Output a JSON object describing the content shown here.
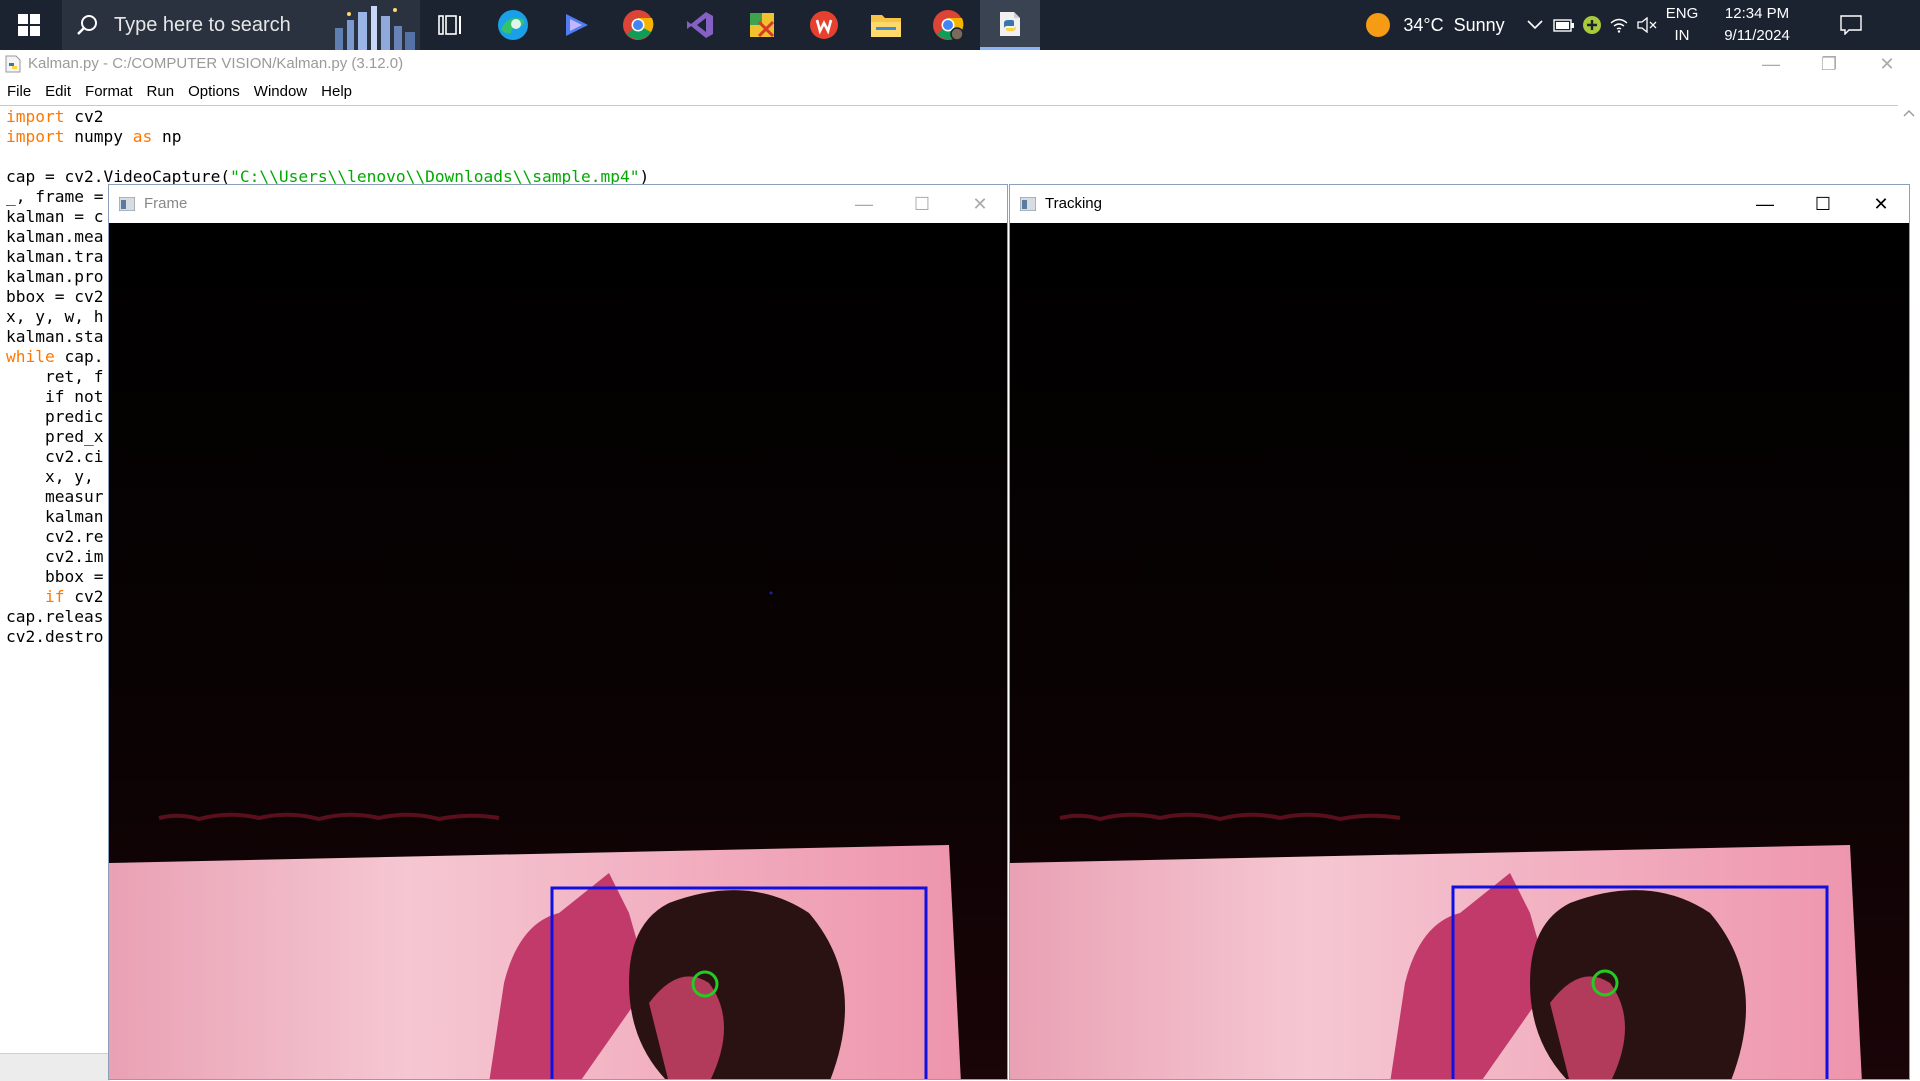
{
  "taskbar": {
    "search_placeholder": "Type here to search",
    "pinned": [
      {
        "name": "task-view"
      },
      {
        "name": "edge"
      },
      {
        "name": "copilot"
      },
      {
        "name": "chrome"
      },
      {
        "name": "visual-studio"
      },
      {
        "name": "app-green"
      },
      {
        "name": "wps-office"
      },
      {
        "name": "file-explorer"
      },
      {
        "name": "chrome-profile"
      },
      {
        "name": "python-idle",
        "active": true
      }
    ],
    "weather": {
      "temp": "34°C",
      "condition": "Sunny"
    },
    "lang": {
      "line1": "ENG",
      "line2": "IN"
    },
    "clock": {
      "time": "12:34 PM",
      "date": "9/11/2024"
    }
  },
  "idle": {
    "title": "Kalman.py - C:/COMPUTER VISION/Kalman.py (3.12.0)",
    "menu": [
      "File",
      "Edit",
      "Format",
      "Run",
      "Options",
      "Window",
      "Help"
    ],
    "code": {
      "l1_kw": "import",
      "l1_rest": " cv2",
      "l2_kw": "import",
      "l2_mid": " numpy ",
      "l2_kw2": "as",
      "l2_rest": " np",
      "l4_pre": "cap = cv2.VideoCapture(",
      "l4_str": "\"C:\\\\Users\\\\lenovo\\\\Downloads\\\\sample.mp4\"",
      "l4_post": ")",
      "l5": "_, frame =",
      "l6": "kalman = c",
      "l7": "kalman.mea",
      "l8": "kalman.tra",
      "l9": "kalman.pro",
      "l10": "bbox = cv2",
      "l11": "x, y, w, h",
      "l12": "kalman.sta",
      "l13_kw": "while",
      "l13_rest": " cap.",
      "l14": "    ret, f",
      "l15_kw": "    if not",
      "l16": "    predic",
      "l17": "    pred_x",
      "l18": "    cv2.ci",
      "l19": "    x, y, ",
      "l20": "    measur",
      "l21": "    kalman",
      "l22": "    cv2.re",
      "l23": "    cv2.im",
      "l24": "    bbox =",
      "l25_kw": "    if",
      "l25_rest": " cv2",
      "l26": "cap.releas",
      "l27": "cv2.destro"
    }
  },
  "windows": {
    "frame": {
      "title": "Frame"
    },
    "tracking": {
      "title": "Tracking"
    }
  },
  "colors": {
    "taskbar_bg": "#1c2330",
    "keyword": "#ff7700",
    "string": "#00aa00",
    "bbox": "#1010e0",
    "circle": "#22cc22"
  }
}
